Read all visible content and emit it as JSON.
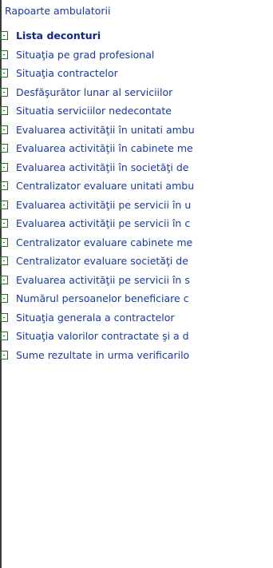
{
  "tree": {
    "root_label": "Rapoarte ambulatorii",
    "items": [
      {
        "label": "Lista deconturi",
        "selected": true
      },
      {
        "label": "Situaţia pe grad profesional"
      },
      {
        "label": "Situaţia contractelor"
      },
      {
        "label": "Desfăşurător lunar al serviciilor"
      },
      {
        "label": "Situatia serviciilor nedecontate"
      },
      {
        "label": "Evaluarea activităţii în unitati ambu"
      },
      {
        "label": "Evaluarea activităţii în cabinete me"
      },
      {
        "label": "Evaluarea activităţii în societăţi de"
      },
      {
        "label": "Centralizator evaluare unitati ambu"
      },
      {
        "label": "Evaluarea activităţii pe servicii în u"
      },
      {
        "label": "Evaluarea activităţii pe servicii în c"
      },
      {
        "label": "Centralizator evaluare cabinete me"
      },
      {
        "label": "Centralizator evaluare societăţi de"
      },
      {
        "label": "Evaluarea activităţii pe servicii în s"
      },
      {
        "label": "Numărul persoanelor beneficiare c"
      },
      {
        "label": "Situaţia generala a contractelor"
      },
      {
        "label": "Situaţia valorilor contractate şi a d"
      },
      {
        "label": "Sume rezultate in urma verificarilo"
      }
    ]
  },
  "colors": {
    "link": "#1a3a9c",
    "icon": "#2e6b2e",
    "border": "#3a3a3a"
  }
}
